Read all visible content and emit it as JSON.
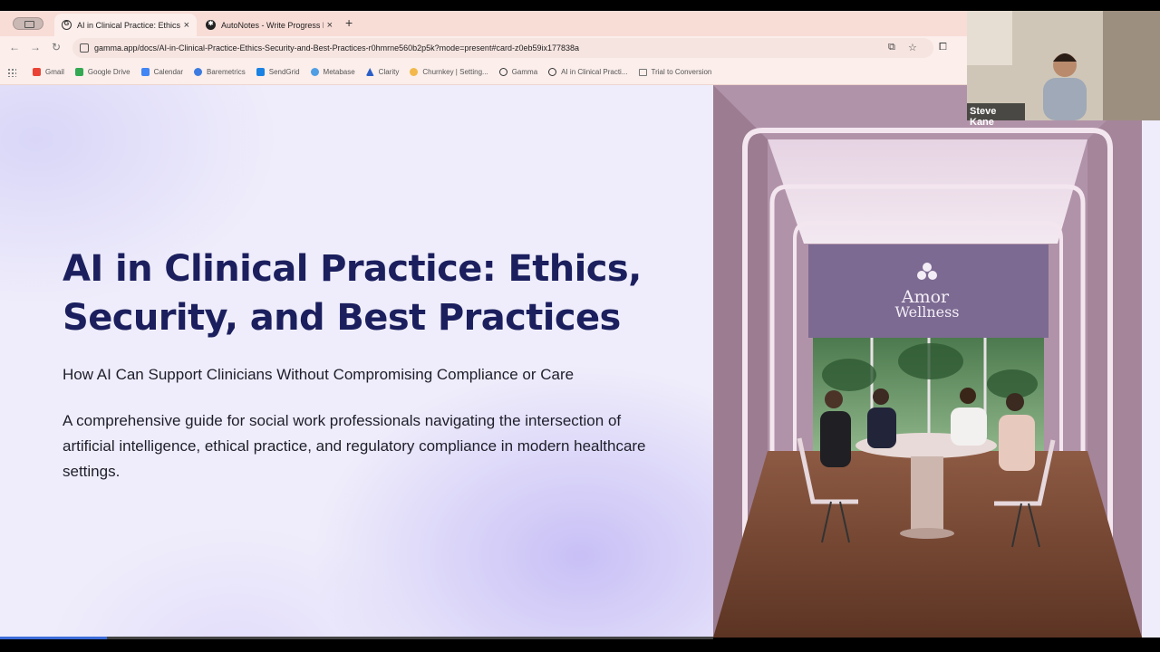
{
  "browser": {
    "tabs": [
      {
        "title": "AI in Clinical Practice: Ethics",
        "favicon": "gamma-icon",
        "active": true
      },
      {
        "title": "AutoNotes - Write Progress N",
        "favicon": "autonotes-icon",
        "active": false
      }
    ],
    "new_tab_label": "+",
    "close_label": "×",
    "url": "gamma.app/docs/AI-in-Clinical-Practice-Ethics-Security-and-Best-Practices-r0hmrne560b2p5k?mode=present#card-z0eb59ix177838a",
    "bookmarks": [
      {
        "label": "Gmail",
        "icon": "gmail-icon",
        "color": "#ea4335"
      },
      {
        "label": "Google Drive",
        "icon": "drive-icon",
        "color": "#34a853"
      },
      {
        "label": "Calendar",
        "icon": "calendar-icon",
        "color": "#4285f4"
      },
      {
        "label": "Baremetrics",
        "icon": "baremetrics-icon",
        "color": "#3d7be0"
      },
      {
        "label": "SendGrid",
        "icon": "sendgrid-icon",
        "color": "#1a82e2"
      },
      {
        "label": "Metabase",
        "icon": "metabase-icon",
        "color": "#509ee3"
      },
      {
        "label": "Clarity",
        "icon": "clarity-icon",
        "color": "#2b5fc7"
      },
      {
        "label": "Churnkey | Setting...",
        "icon": "churnkey-icon",
        "color": "#f2b84b"
      },
      {
        "label": "Gamma",
        "icon": "gamma-icon",
        "color": "#333333"
      },
      {
        "label": "AI in Clinical Practi...",
        "icon": "gamma-icon",
        "color": "#333333"
      },
      {
        "label": "Trial to Conversion",
        "icon": "folder-icon",
        "color": "#777777"
      }
    ]
  },
  "slide": {
    "title": "AI in Clinical Practice: Ethics, Security, and Best Practices",
    "subtitle": "How AI Can Support Clinicians Without Compromising Compliance or Care",
    "body": "A comprehensive guide for social work professionals navigating the intersection of artificial intelligence, ethical practice, and regulatory compliance in modern healthcare settings."
  },
  "image": {
    "sign_line1": "Amor",
    "sign_line2": "Wellness"
  },
  "video": {
    "participant_name": "Steve Kane"
  },
  "presentation": {
    "progress": 0.15
  }
}
